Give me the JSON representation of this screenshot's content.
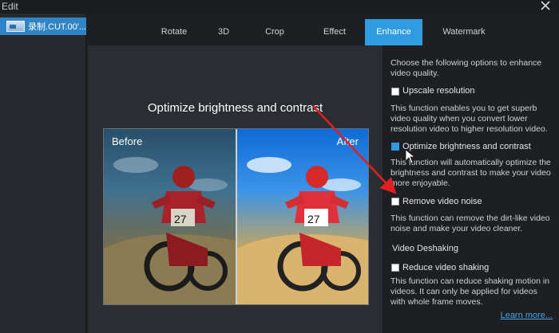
{
  "window": {
    "title": "Edit"
  },
  "file_list": {
    "items": [
      {
        "label": "录制.CUT.00'..."
      }
    ]
  },
  "tabs": [
    {
      "label": "Rotate",
      "active": false
    },
    {
      "label": "3D",
      "active": false
    },
    {
      "label": "Crop",
      "active": false
    },
    {
      "label": "Effect",
      "active": false
    },
    {
      "label": "Enhance",
      "active": true
    },
    {
      "label": "Watermark",
      "active": false
    }
  ],
  "preview": {
    "title": "Optimize brightness and contrast",
    "before_label": "Before",
    "after_label": "After"
  },
  "enhance": {
    "intro": "Choose the following options to enhance video quality.",
    "options": [
      {
        "label": "Upscale resolution",
        "checked": false,
        "description": "This function enables you to get superb video quality when you convert lower resolution video to higher resolution video."
      },
      {
        "label": "Optimize brightness and contrast",
        "checked": true,
        "description": "This function will automatically optimize the brightness and contrast to make your video more enjoyable."
      },
      {
        "label": "Remove video noise",
        "checked": false,
        "description": "This function can remove the dirt-like video noise and make your video cleaner."
      }
    ],
    "deshake": {
      "section_title": "Video Deshaking",
      "label": "Reduce video shaking",
      "checked": false,
      "description": "This function can reduce shaking motion in videos. It can only be applied for videos with whole frame moves."
    },
    "learn_more": "Learn more..."
  },
  "colors": {
    "accent": "#2f9be0",
    "arrow": "#e02020"
  }
}
